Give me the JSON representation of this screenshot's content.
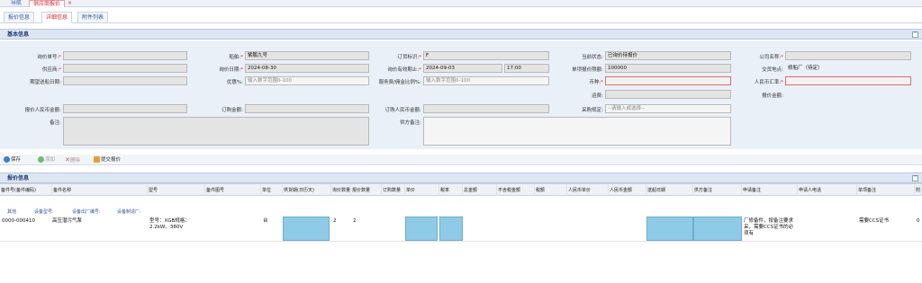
{
  "nav": {
    "tab_nav": "导航",
    "tab_supplier_quote": "供应商报价",
    "close": "×"
  },
  "subtabs": [
    "报价信息",
    "详细信息",
    "附件列表"
  ],
  "basic_section": {
    "title": "基本信息"
  },
  "form": {
    "rfq_no": {
      "label": "询价单号:",
      "value": ""
    },
    "supplier": {
      "label": "供应商:",
      "value": ""
    },
    "expected_delivery": {
      "label": "期望送船日期:",
      "value": ""
    },
    "quote_rmb_amount": {
      "label": "报价人民币金额:",
      "value": ""
    },
    "remarks": {
      "label": "备注:",
      "value": ""
    },
    "vessel": {
      "label": "船舶:",
      "value": "紫鹏九号"
    },
    "inquiry_date": {
      "label": "询价日期:",
      "value": "2024-08-30"
    },
    "discount": {
      "label": "优惠%:",
      "placeholder": "输入数字范围0-100"
    },
    "order_amount": {
      "label": "订购金额:",
      "value": ""
    },
    "order_flag": {
      "label": "订货标识:",
      "value": "F"
    },
    "valid_until": {
      "label": "询价有效期止:",
      "date": "2024-09-03",
      "time": "17:00"
    },
    "service_fee": {
      "label": "服务费/佣金比例%:",
      "placeholder": "输入数字范围0-100"
    },
    "order_rmb_amount": {
      "label": "订购人民币金额:",
      "value": ""
    },
    "supplier_remarks": {
      "label": "供方备注:",
      "value": ""
    },
    "current_status": {
      "label": "当前状态:",
      "value": "已询价待报价"
    },
    "single_quote_limit": {
      "label": "单项报价限额:",
      "value": "100000"
    },
    "currency": {
      "label": "币种:",
      "value": ""
    },
    "shipping_fee": {
      "label": "运费:",
      "value": ""
    },
    "purchase_rule": {
      "label": "采购规定:",
      "value": "--请输入或选择--"
    },
    "company": {
      "label": "公司名称:",
      "value": ""
    },
    "delivery_method": {
      "label": "交货地点:",
      "value": "修船厂（待定）"
    },
    "rmb_rate": {
      "label": "人民币汇率:",
      "value": ""
    },
    "quote_amount": {
      "label": "报价金额:",
      "value": ""
    }
  },
  "toolbar": {
    "save": "保存",
    "add": "添加",
    "delete": "删除",
    "submit": "提交报价"
  },
  "quote_section": {
    "title": "报价信息"
  },
  "grid": {
    "headers": [
      "备件号(备件编码)",
      "备件名称",
      "型号",
      "备件图号",
      "单位",
      "供货期(日历天)",
      "询价数量",
      "报价数量",
      "订购数量",
      "单价",
      "税率",
      "总金额",
      "不含税金额",
      "税额",
      "人民币单价",
      "人民币金额",
      "送船日期",
      "供方备注",
      "申请备注",
      "申请人电话",
      "单项备注",
      "附"
    ],
    "filters": [
      "其他",
      "设备型号:",
      "设备出厂编号:",
      "设备制造厂:"
    ],
    "row": {
      "part_no": "0000-000410",
      "part_name": "高压潜污气泵",
      "model_line1": "型号：XGB规格：",
      "model_line2": "2.2kW、380V",
      "unit": "台",
      "inquiry_qty": "2",
      "quote_qty": "2",
      "apply_remark": "厂修备件，按备注要求采，需要CCS证书的必须有",
      "item_remark": "需要CCS证书",
      "last": "0"
    }
  }
}
